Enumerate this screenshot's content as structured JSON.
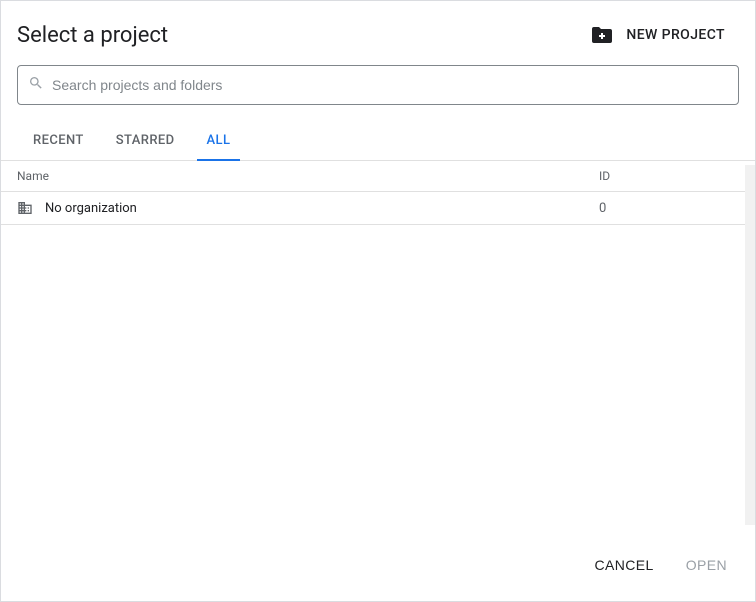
{
  "dialog": {
    "title": "Select a project",
    "new_project_label": "NEW PROJECT"
  },
  "search": {
    "placeholder": "Search projects and folders",
    "value": ""
  },
  "tabs": [
    {
      "label": "RECENT",
      "active": false
    },
    {
      "label": "STARRED",
      "active": false
    },
    {
      "label": "ALL",
      "active": true
    }
  ],
  "columns": {
    "name": "Name",
    "id": "ID"
  },
  "rows": [
    {
      "icon": "organization",
      "name": "No organization",
      "id": "0"
    }
  ],
  "footer": {
    "cancel": "CANCEL",
    "open": "OPEN"
  }
}
